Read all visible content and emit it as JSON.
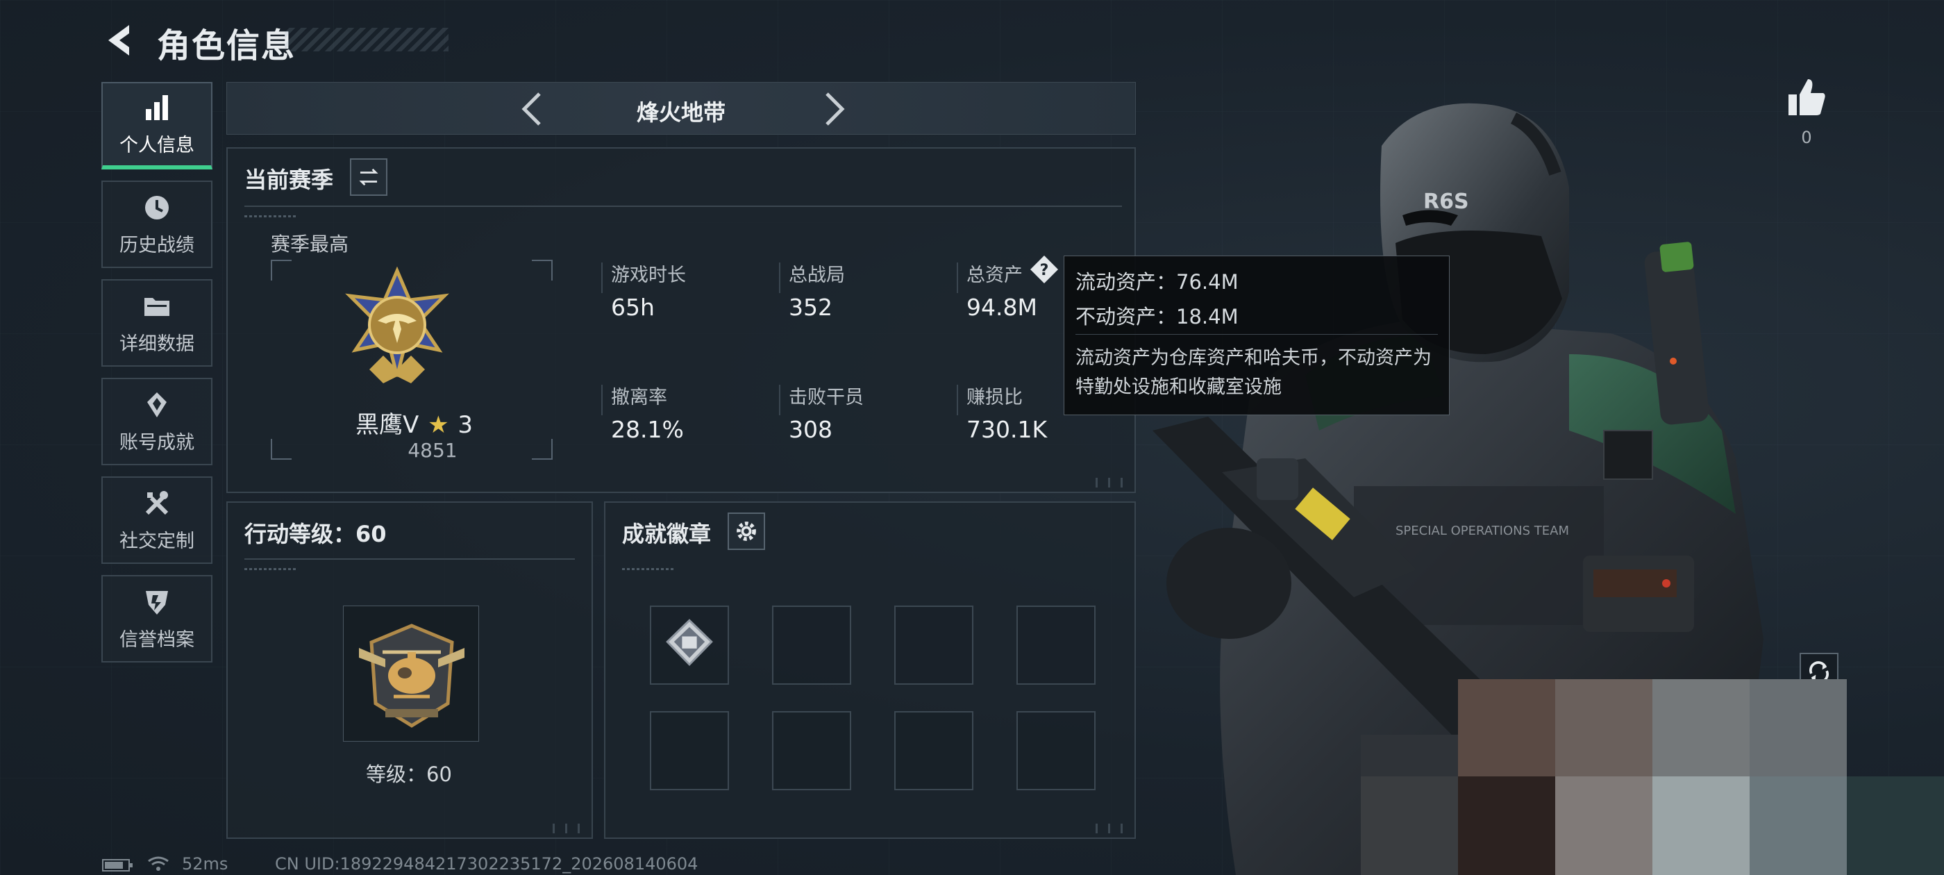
{
  "header": {
    "title": "角色信息"
  },
  "nav": {
    "items": [
      {
        "label": "个人信息",
        "icon": "bar-chart-icon",
        "active": true
      },
      {
        "label": "历史战绩",
        "icon": "history-icon",
        "active": false
      },
      {
        "label": "详细数据",
        "icon": "folder-icon",
        "active": false
      },
      {
        "label": "账号成就",
        "icon": "achievement-icon",
        "active": false
      },
      {
        "label": "社交定制",
        "icon": "tools-icon",
        "active": false
      },
      {
        "label": "信誉档案",
        "icon": "credit-shield-icon",
        "active": false
      }
    ]
  },
  "mode": {
    "name": "烽火地带"
  },
  "season": {
    "title": "当前赛季",
    "best_label": "赛季最高",
    "rank_name": "黑鹰Ⅴ",
    "rank_stars": "3",
    "rank_score": "4851",
    "stats": [
      {
        "label": "游戏时长",
        "value": "65h"
      },
      {
        "label": "总战局",
        "value": "352"
      },
      {
        "label": "总资产",
        "value": "94.8M"
      },
      {
        "label": "撤离率",
        "value": "28.1%"
      },
      {
        "label": "击败干员",
        "value": "308"
      },
      {
        "label": "赚损比",
        "value": "730.1K"
      }
    ]
  },
  "tooltip": {
    "liquid": "流动资产：76.4M",
    "fixed": "不动资产：18.4M",
    "description": "流动资产为仓库资产和哈夫币，不动资产为特勤处设施和收藏室设施"
  },
  "level_panel": {
    "title": "行动等级：60",
    "level_text": "等级：60"
  },
  "achievements": {
    "title": "成就徽章",
    "slots_filled": 1,
    "slots_total": 8
  },
  "likes": {
    "count": "0"
  },
  "status_bar": {
    "ping": "52ms",
    "uid": "CN UID:18922948421730223517​2_202608140604"
  },
  "colors": {
    "accent": "#3fcf8e",
    "panel_border": "#38444e",
    "background": "#1a232c"
  }
}
